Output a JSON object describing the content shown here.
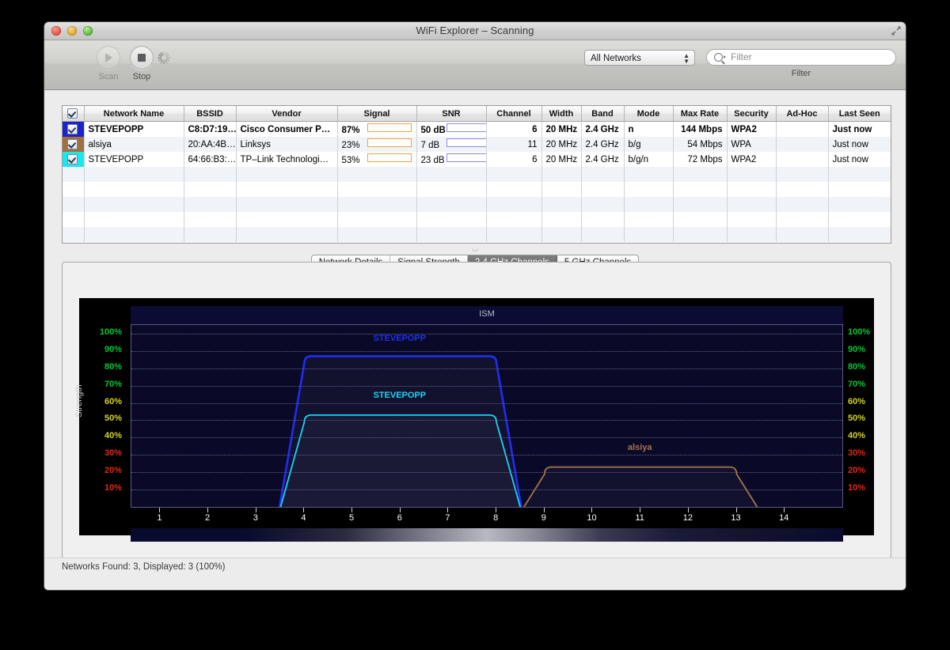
{
  "window": {
    "title": "WiFi Explorer – Scanning",
    "fullscreen_icon": "fullscreen-arrows-icon",
    "close_icon": "close-icon",
    "minimize_icon": "minimize-icon",
    "zoom_icon": "zoom-icon"
  },
  "toolbar": {
    "scan_label": "Scan",
    "scan_icon": "play-icon",
    "stop_label": "Stop",
    "stop_icon": "stop-square-icon",
    "spinner_icon": "progress-spinner-icon",
    "network_filter_value": "All Networks",
    "network_filter_options": [
      "All Networks"
    ],
    "search_placeholder": "Filter",
    "search_value": "",
    "search_icon": "search-magnifier-icon",
    "filter_caption": "Filter"
  },
  "table": {
    "select_all_checked": true,
    "columns": [
      "Network Name",
      "BSSID",
      "Vendor",
      "Signal",
      "SNR",
      "Channel",
      "Width",
      "Band",
      "Mode",
      "Max Rate",
      "Security",
      "Ad-Hoc",
      "Last Seen"
    ],
    "rows": [
      {
        "checked": true,
        "color": "#1c24c8",
        "network_name": "STEVEPOPP",
        "bssid": "C8:D7:19…",
        "vendor": "Cisco Consumer P…",
        "signal_text": "87%",
        "signal_pct": 87,
        "snr_text": "50 dB",
        "snr_pct": 83,
        "channel": "6",
        "width": "20 MHz",
        "band": "2.4 GHz",
        "mode": "n",
        "max_rate": "144 Mbps",
        "security": "WPA2",
        "adhoc": "",
        "last_seen": "Just now"
      },
      {
        "checked": true,
        "color": "#a0713f",
        "network_name": "alsiya",
        "bssid": "20:AA:4B…",
        "vendor": "Linksys",
        "signal_text": "23%",
        "signal_pct": 23,
        "snr_text": "7 dB",
        "snr_pct": 15,
        "channel": "11",
        "width": "20 MHz",
        "band": "2.4 GHz",
        "mode": "b/g",
        "max_rate": "54 Mbps",
        "security": "WPA",
        "adhoc": "",
        "last_seen": "Just now"
      },
      {
        "checked": true,
        "color": "#19e8f0",
        "network_name": "STEVEPOPP",
        "bssid": "64:66:B3:…",
        "vendor": "TP–Link Technologi…",
        "signal_text": "53%",
        "signal_pct": 53,
        "snr_text": "23 dB",
        "snr_pct": 45,
        "channel": "6",
        "width": "20 MHz",
        "band": "2.4 GHz",
        "mode": "b/g/n",
        "max_rate": "72 Mbps",
        "security": "WPA2",
        "adhoc": "",
        "last_seen": "Just now"
      }
    ]
  },
  "tabs": [
    {
      "label": "Network Details",
      "active": false
    },
    {
      "label": "Signal Strength",
      "active": false
    },
    {
      "label": "2.4 GHz Channels",
      "active": true
    },
    {
      "label": "5 GHz Channels",
      "active": false
    }
  ],
  "chart_data": {
    "type": "area",
    "title": "2.4 GHz Channels",
    "band_label": "ISM",
    "xlabel": "",
    "ylabel": "Strength",
    "x_tick_labels": [
      "1",
      "2",
      "3",
      "4",
      "5",
      "6",
      "7",
      "8",
      "9",
      "10",
      "11",
      "12",
      "13",
      "14"
    ],
    "x_ticks": [
      1,
      2,
      3,
      4,
      5,
      6,
      7,
      8,
      9,
      10,
      11,
      12,
      13,
      14
    ],
    "xlim": [
      0.4,
      15.2
    ],
    "y_tick_labels": [
      "100%",
      "90%",
      "80%",
      "70%",
      "60%",
      "50%",
      "40%",
      "30%",
      "20%",
      "10%"
    ],
    "y_ticks": [
      100,
      90,
      80,
      70,
      60,
      50,
      40,
      30,
      20,
      10
    ],
    "y_tick_colors": [
      "#00c838",
      "#00c838",
      "#00c838",
      "#00c838",
      "#d4d41c",
      "#d4d41c",
      "#d4d41c",
      "#e02818",
      "#e02818",
      "#e02818"
    ],
    "ylim": [
      0,
      105
    ],
    "grid": true,
    "legend_position": "inline-above-curve",
    "series": [
      {
        "name": "STEVEPOPP",
        "color": "#1f2ef0",
        "center_channel": 6,
        "peak_percent": 87,
        "label_percent": 96,
        "half_width_channels": 2.0,
        "skirt_width_channels": 2.55
      },
      {
        "name": "STEVEPOPP",
        "color": "#19d4f5",
        "center_channel": 6,
        "peak_percent": 53,
        "label_percent": 63,
        "half_width_channels": 2.0,
        "skirt_width_channels": 2.55
      },
      {
        "name": "alsiya",
        "color": "#a3764a",
        "center_channel": 11,
        "peak_percent": 23,
        "label_percent": 33,
        "half_width_channels": 2.0,
        "skirt_width_channels": 2.55
      }
    ]
  },
  "status": {
    "text": "Networks Found: 3, Displayed: 3 (100%)"
  }
}
